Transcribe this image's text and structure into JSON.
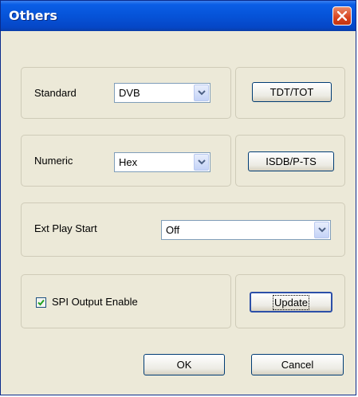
{
  "window": {
    "title": "Others"
  },
  "standard": {
    "label": "Standard",
    "value": "DVB",
    "button": "TDT/TOT"
  },
  "numeric": {
    "label": "Numeric",
    "value": "Hex",
    "button": "ISDB/P-TS"
  },
  "ext_play": {
    "label": "Ext Play Start",
    "value": "Off"
  },
  "spi": {
    "label": "SPI Output Enable",
    "checked": true,
    "button": "Update"
  },
  "footer": {
    "ok": "OK",
    "cancel": "Cancel"
  }
}
